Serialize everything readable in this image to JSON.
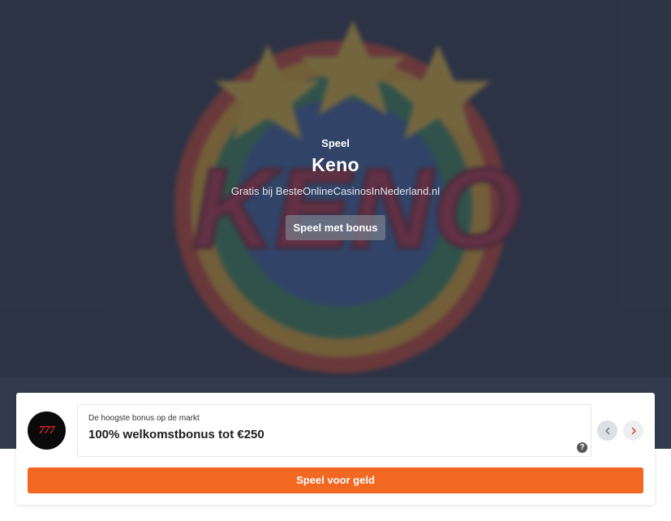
{
  "hero": {
    "eyebrow": "Speel",
    "title": "Keno",
    "subtitle": "Gratis bij BesteOnlineCasinosInNederland.nl",
    "bonus_button": "Speel met bonus",
    "background_word": "KENO"
  },
  "offer_card": {
    "logo_text": "777",
    "label": "De hoogste bonus op de markt",
    "offer": "100% welkomstbonus tot €250",
    "help_icon": "question-icon",
    "prev_icon": "chevron-left-icon",
    "next_icon": "chevron-right-icon",
    "play_button": "Speel voor geld"
  },
  "colors": {
    "hero_bg": "#2f3749",
    "accent": "#f26722",
    "logo_red": "#e3262b"
  }
}
